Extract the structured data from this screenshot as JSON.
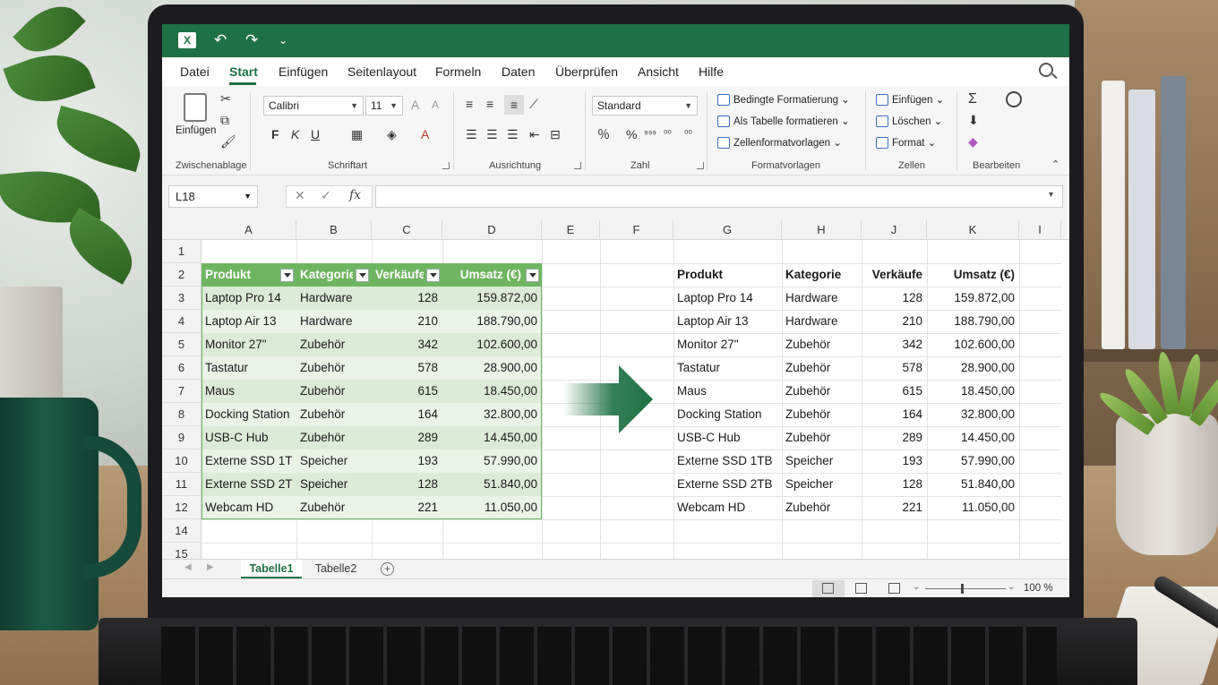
{
  "excel": {
    "app_icon_letter": "X",
    "qa_undo": "↶",
    "qa_redo": "↷",
    "qa_more": "⌄",
    "menu": [
      "Datei",
      "Start",
      "Einfügen",
      "Seitenlayout",
      "Formeln",
      "Daten",
      "Überprüfen",
      "Ansicht",
      "Hilfe"
    ],
    "active_menu": "Start",
    "ribbon": {
      "clipboard": {
        "paste_label": "Einfügen",
        "group_label": "Zwischenablage"
      },
      "font": {
        "font_name": "Calibri",
        "font_size": "11",
        "bold": "F",
        "italic": "K",
        "underline": "U",
        "group_label": "Schriftart"
      },
      "alignment": {
        "group_label": "Ausrichtung"
      },
      "number": {
        "format": "Standard",
        "percent": "%",
        "group_label": "Zahl"
      },
      "styles": {
        "conditional": "Bedingte Formatierung",
        "as_table": "Als Tabelle formatieren",
        "cell_styles": "Zellenformatvorlagen",
        "group_label": "Formatvorlagen"
      },
      "cells": {
        "insert": "Einfügen",
        "delete": "Löschen",
        "format": "Format",
        "group_label": "Zellen"
      },
      "editing": {
        "sum_glyph": "Σ",
        "group_label": "Bearbeiten"
      }
    },
    "namebox": "L18",
    "fx_label": "fx",
    "columns": [
      "A",
      "B",
      "C",
      "D",
      "E",
      "F",
      "G",
      "H",
      "J",
      "K",
      "I"
    ],
    "rows": [
      "1",
      "2",
      "3",
      "4",
      "5",
      "6",
      "7",
      "8",
      "9",
      "10",
      "11",
      "12",
      "14",
      "15"
    ],
    "table_headers": [
      "Produkt",
      "Kategorie",
      "Verkäufe",
      "Umsatz (€)"
    ],
    "table_rows": [
      [
        "Laptop Pro 14",
        "Hardware",
        "128",
        "159.872,00"
      ],
      [
        "Laptop Air 13",
        "Hardware",
        "210",
        "188.790,00"
      ],
      [
        "Monitor 27\"",
        "Zubehör",
        "342",
        "102.600,00"
      ],
      [
        "Tastatur",
        "Zubehör",
        "578",
        "28.900,00"
      ],
      [
        "Maus",
        "Zubehör",
        "615",
        "18.450,00"
      ],
      [
        "Docking Station",
        "Zubehör",
        "164",
        "32.800,00"
      ],
      [
        "USB-C Hub",
        "Zubehör",
        "289",
        "14.450,00"
      ],
      [
        "Externe SSD 1TB",
        "Speicher",
        "193",
        "57.990,00"
      ],
      [
        "Externe SSD 2TB",
        "Speicher",
        "128",
        "51.840,00"
      ],
      [
        "Webcam HD",
        "Zubehör",
        "221",
        "11.050,00"
      ]
    ],
    "sheets": [
      "Tabelle1",
      "Tabelle2"
    ],
    "active_sheet": "Tabelle1",
    "add_sheet_glyph": "+",
    "zoom": "100 %",
    "colors": {
      "brand": "#1e7145",
      "table_header": "#6fb561",
      "band_light": "#e9f3e6",
      "band_mid": "#dcebd7"
    }
  }
}
